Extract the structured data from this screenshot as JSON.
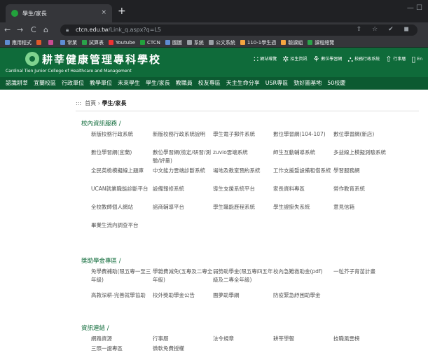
{
  "browser": {
    "tab_title": "學生/家長",
    "tab_close": "×",
    "new_tab": "+",
    "window_controls": "—  ☐",
    "url_host": "ctcn.edu.tw",
    "url_path": "/Link_q.aspx?q=L5",
    "nav": {
      "back": "←",
      "forward": "→",
      "reload": "C",
      "home": "⌂"
    },
    "omni_icons": "⇪ ☆ ✔ ◼",
    "bookmarks": [
      {
        "label": "應用程式",
        "color": "#5f8dd3"
      },
      {
        "label": "",
        "color": "#e05a2a"
      },
      {
        "label": "",
        "color": "#c94c92"
      },
      {
        "label": "常業",
        "color": "#5f8dd3"
      },
      {
        "label": "試算表",
        "color": "#2aa34a"
      },
      {
        "label": "Youtube",
        "color": "#e33"
      },
      {
        "label": "CTCN",
        "color": "#22a13c"
      },
      {
        "label": "國圖",
        "color": "#5f8dd3"
      },
      {
        "label": "系統",
        "color": "#9aa0a6"
      },
      {
        "label": "公文系統",
        "color": "#9aa0a6"
      },
      {
        "label": "110-1學生週",
        "color": "#f4a640"
      },
      {
        "label": "驗課組",
        "color": "#f4a640"
      },
      {
        "label": "課程總覽",
        "color": "#2aa34a"
      }
    ]
  },
  "site": {
    "name": "耕莘健康管理專科學校",
    "name_en": "Cardinal Tien Junior College of Healthcare and Management",
    "toplinks": [
      {
        "icon": "∷",
        "label": "網站導覽"
      },
      {
        "icon": "✲",
        "label": "招生資訊"
      },
      {
        "icon": "⚘",
        "label": "數位學習網"
      },
      {
        "icon": "⛬",
        "label": "校務行政系統"
      },
      {
        "icon": "⇧",
        "label": "行事曆"
      },
      {
        "icon": "▯",
        "label": "En"
      }
    ],
    "mainnav": [
      "認識耕莘",
      "宜蘭校區",
      "行政單位",
      "教學單位",
      "未來學生",
      "學生/家長",
      "教職員",
      "校友專區",
      "天主生命分享",
      "USR專區",
      "勁好圖基地",
      "50校慶"
    ]
  },
  "breadcrumb": {
    "icon": ":::",
    "home": "首頁",
    "sep": "›",
    "current": "學生/家長"
  },
  "sections": [
    {
      "title": "校內資訊服務 /",
      "items": [
        "新版校務行政系統",
        "新版校務行政系統說明",
        "學生電子郵件系統",
        "數位學習網(104-107)",
        "數位學習網(新店)",
        "數位學習網(宜蘭)",
        "數位學習網(檢定/研習/測驗/評量)",
        "zuvio雲端系統",
        "師生互動輔導系統",
        "多益線上模擬測驗系統",
        "全民英檢模擬線上題庫",
        "中文能力雲端診斷系統",
        "場地及教室預約系統",
        "工作支援暨設備租借系統",
        "學習服務網",
        "UCAN就業職能診斷平台",
        "設備報修系統",
        "導生支援系統平台",
        "家長資料專區",
        "勞作教育系統",
        "全校教師個人網站",
        "諮商輔導平台",
        "學生職能歷程系統",
        "學生證掛失系統",
        "意見信箱",
        "畢業生流向調查平台"
      ]
    },
    {
      "title": "獎助學金專區 /",
      "items": [
        "免學費補助(限五專一至三年級)",
        "學雜費減免(五專及二專全年級)",
        "弱勢助學金(限五專四五年級及二專全年級)",
        "校內急難救助金(pdf)",
        "一粒芥子育苗計畫",
        "高教深耕-完善就學協助",
        "校外獎助學金公告",
        "團夢助學網",
        "防疫緊急紓困助學金"
      ]
    },
    {
      "title": "資訊連結 /",
      "items": [
        "網路資源",
        "行事曆",
        "法令規章",
        "耕莘學報",
        "技職風雲榜",
        "三照一證專區",
        "微軟免費授權"
      ]
    }
  ]
}
